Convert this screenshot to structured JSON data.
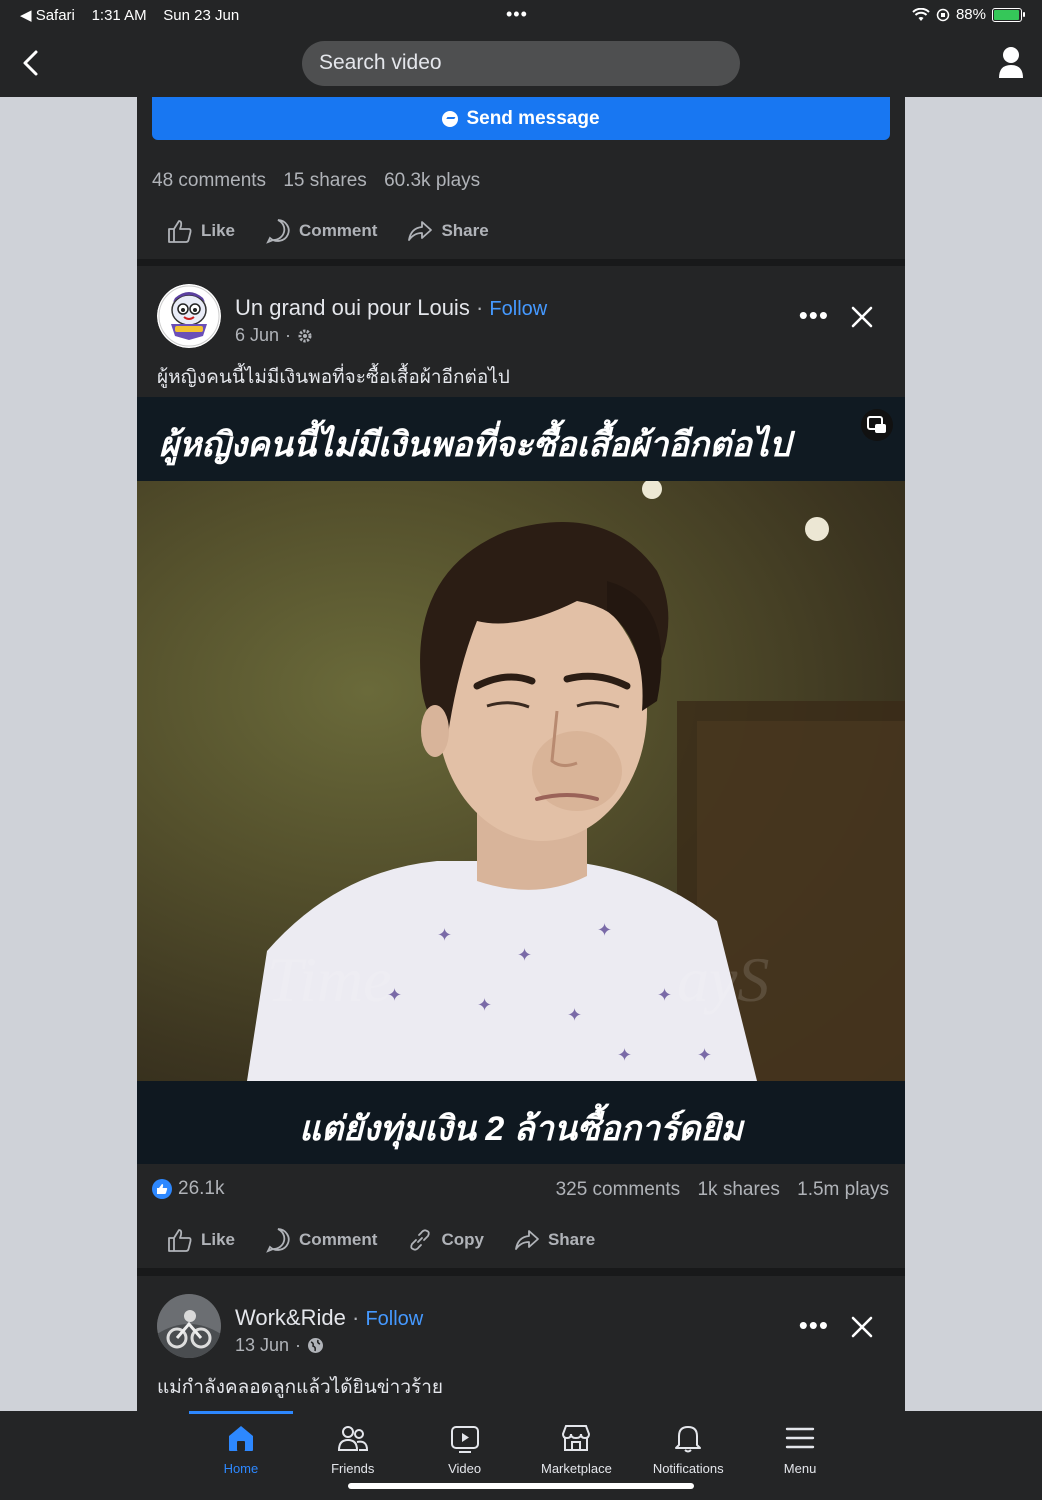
{
  "status_bar": {
    "back_app": "◀ Safari",
    "time": "1:31 AM",
    "date": "Sun 23 Jun",
    "battery_percent": "88%",
    "battery_level": 0.88
  },
  "topnav": {
    "search_text": "Search video"
  },
  "card1": {
    "send_message": "Send message",
    "comments": "48 comments",
    "shares": "15 shares",
    "plays": "60.3k plays",
    "like": "Like",
    "comment": "Comment",
    "share": "Share"
  },
  "card2": {
    "page_name": "Un grand oui pour Louis",
    "follow": "Follow",
    "date": "6 Jun",
    "caption": "ผู้หญิงคนนี้ไม่มีเงินพอที่จะซื้อเสื้อผ้าอีกต่อไป",
    "video_top_text": "ผู้หญิงคนนี้ไม่มีเงินพอที่จะซื้อเสื้อผ้าอีกต่อไป",
    "video_bottom_text": "แต่ยังทุ่มเงิน 2 ล้านซื้อการ์ดยิม",
    "reactions": "26.1k",
    "comments": "325 comments",
    "shares": "1k shares",
    "plays": "1.5m plays",
    "like": "Like",
    "comment": "Comment",
    "copy": "Copy",
    "share": "Share"
  },
  "card3": {
    "page_name": "Work&Ride",
    "follow": "Follow",
    "date": "13 Jun",
    "caption": "แม่กำลังคลอดลูกแล้วได้ยินข่าวร้าย"
  },
  "tabbar": {
    "tabs": [
      {
        "label": "Home",
        "icon": "home-icon",
        "active": true
      },
      {
        "label": "Friends",
        "icon": "friends-icon"
      },
      {
        "label": "Video",
        "icon": "video-icon"
      },
      {
        "label": "Marketplace",
        "icon": "marketplace-icon"
      },
      {
        "label": "Notifications",
        "icon": "bell-icon"
      },
      {
        "label": "Menu",
        "icon": "menu-icon"
      }
    ]
  },
  "colors": {
    "accent": "#1877f2",
    "background": "#242526",
    "follow": "#4599ff"
  }
}
